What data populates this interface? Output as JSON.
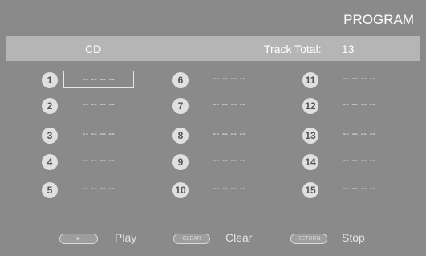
{
  "title": "PROGRAM",
  "info": {
    "disc_type": "CD",
    "track_total_label": "Track Total:",
    "track_total_value": "13"
  },
  "slots": [
    {
      "number": "1",
      "value": "-- -- -- --",
      "selected": true
    },
    {
      "number": "2",
      "value": "-- -- -- --"
    },
    {
      "number": "3",
      "value": "-- -- -- --"
    },
    {
      "number": "4",
      "value": "-- -- -- --"
    },
    {
      "number": "5",
      "value": "-- -- -- --"
    },
    {
      "number": "6",
      "value": "-- -- -- --"
    },
    {
      "number": "7",
      "value": "-- -- -- --"
    },
    {
      "number": "8",
      "value": "-- -- -- --"
    },
    {
      "number": "9",
      "value": "-- -- -- --"
    },
    {
      "number": "10",
      "value": "-- -- -- --"
    },
    {
      "number": "11",
      "value": "-- -- -- --"
    },
    {
      "number": "12",
      "value": "-- -- -- --"
    },
    {
      "number": "13",
      "value": "-- -- -- --"
    },
    {
      "number": "14",
      "value": "-- -- -- --"
    },
    {
      "number": "15",
      "value": "-- -- -- --"
    }
  ],
  "controls": {
    "play_symbol": "►",
    "play_label": "Play",
    "clear_button": "CLEAR",
    "clear_label": "Clear",
    "return_button": "RETURN",
    "stop_label": "Stop"
  }
}
